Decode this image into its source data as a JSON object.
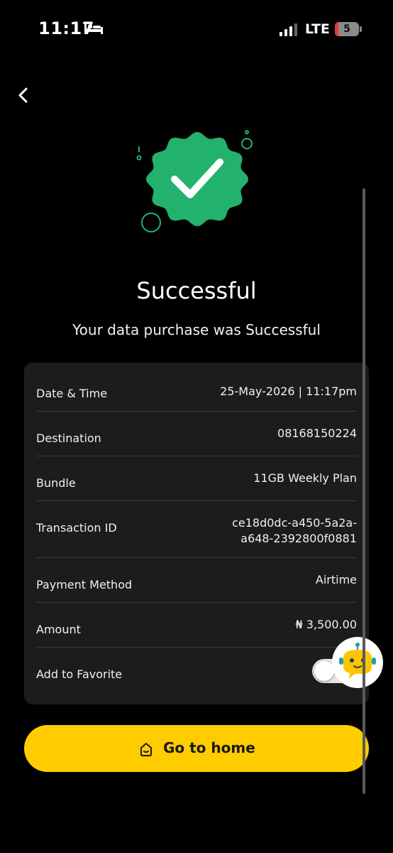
{
  "status_bar": {
    "time": "11:17",
    "network": "LTE",
    "battery_level": "5"
  },
  "header": {
    "title": "Successful",
    "subtitle": "Your data purchase was Successful"
  },
  "details": [
    {
      "label": "Date & Time",
      "value": "25-May-2026 | 11:17pm"
    },
    {
      "label": "Destination",
      "value": "08168150224"
    },
    {
      "label": "Bundle",
      "value": "11GB Weekly Plan"
    },
    {
      "label": "Transaction ID",
      "value": "ce18d0dc-a450-5a2a-a648-2392800f0881",
      "value_line1": "ce18d0dc-a450-5a2a-",
      "value_line2": "a648-2392800f0881"
    },
    {
      "label": "Payment Method",
      "value": "Airtime"
    },
    {
      "label": "Amount",
      "value": "₦ 3,500.00"
    },
    {
      "label": "Add to Favorite",
      "toggle_on": false
    }
  ],
  "home_button": {
    "label": "Go to home",
    "icon": "home-icon"
  },
  "colors": {
    "accent_green": "#23b26d",
    "button_yellow": "#ffcc00",
    "card_bg": "#1c1c1c"
  }
}
